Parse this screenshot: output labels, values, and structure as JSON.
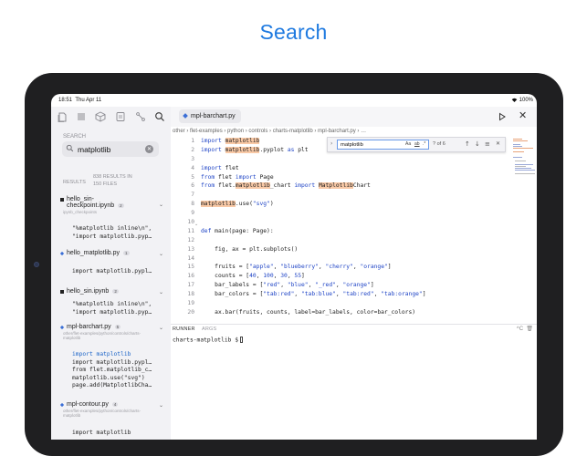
{
  "headline": "Search",
  "status": {
    "time": "18:51",
    "date": "Thu Apr 11",
    "battery": "100%"
  },
  "sidebar": {
    "section_title": "SEARCH",
    "search_value": "matplotlib",
    "results_label": "RESULTS",
    "results_count_line1": "838 RESULTS IN",
    "results_count_line2": "150 FILES",
    "files": [
      {
        "name": "hello_sin-",
        "name2": "checkpoint.ipynb",
        "badge": "2",
        "path": "ipynb_checkpoints",
        "snippets": [
          "\"%matplotlib inline\\n\",",
          "\"import matplotlib.pyp…"
        ]
      },
      {
        "name": "hello_matplotlib.py",
        "badge": "1",
        "snippets": [
          "import matplotlib.pypl…"
        ]
      },
      {
        "name": "hello_sin.ipynb",
        "badge": "2",
        "snippets": [
          "\"%matplotlib inline\\n\",",
          "\"import matplotlib.pyp…"
        ]
      },
      {
        "name": "mpl-barchart.py",
        "badge": "5",
        "path": "other/flet-examples/python/controls/charts-matplotlib",
        "snippets": [
          "import matplotlib",
          "import matplotlib.pypl…",
          "from flet.matplotlib_c…",
          "matplotlib.use(\"svg\")",
          "page.add(MatplotlibCha…"
        ]
      },
      {
        "name": "mpl-contour.py",
        "badge": "4",
        "path": "other/flet-examples/python/controls/charts-matplotlib",
        "snippets": [
          "import matplotlib"
        ]
      }
    ]
  },
  "tab": {
    "label": "mpl-barchart.py"
  },
  "breadcrumb": "other › flet-examples › python › controls › charts-matplotlib › mpl-barchart.py › …",
  "find": {
    "value": "matplotlib",
    "opt_case": "Aa",
    "opt_word": "ab",
    "opt_regex": ".*",
    "count": "? of 6"
  },
  "editor": {
    "line_numbers": [
      "1",
      "2",
      "3",
      "4",
      "5",
      "6",
      "7",
      "8",
      "9",
      "10",
      "11",
      "12",
      "13",
      "14",
      "15",
      "16",
      "17",
      "18",
      "19",
      "20"
    ]
  },
  "panel": {
    "tab_runner": "RUNNER",
    "tab_args": "ARGS",
    "right": "^C",
    "prompt": "charts-matplotlib $"
  }
}
